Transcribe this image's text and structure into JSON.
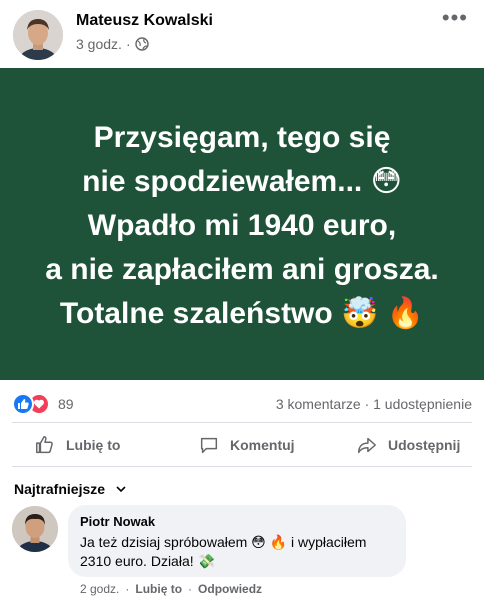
{
  "post": {
    "author": "Mateusz Kowalski",
    "time": "3 godz.",
    "separator": "·",
    "privacy_icon": "globe-icon",
    "more_icon": "more-options-icon",
    "banner_color": "#1f5339",
    "banner_lines": [
      "Przysięgam, tego się",
      "nie spodziewałem... 😳",
      "Wpadło mi 1940 euro,",
      "a nie zapłaciłem ani grosza.",
      "Totalne szaleństwo 🤯 🔥"
    ]
  },
  "reactions": {
    "count": "89",
    "icons": [
      "like-icon",
      "love-icon"
    ],
    "comments": "3 komentarze",
    "separator": "·",
    "shares": "1 udostępnienie"
  },
  "actions": {
    "like": "Lubię to",
    "comment": "Komentuj",
    "share": "Udostępnij"
  },
  "comments_section": {
    "sort_label": "Najtrafniejsze",
    "items": [
      {
        "author": "Piotr Nowak",
        "text": "Ja też dzisiaj spróbowałem 😳 🔥 i wypłaciłem 2310 euro. Działa! 💸",
        "time": "2 godz.",
        "like": "Lubię to",
        "reply": "Odpowiedz",
        "separator": "·"
      }
    ]
  },
  "colors": {
    "accent": "#1877f2",
    "love": "#f33e58",
    "muted_text": "#65676b"
  }
}
